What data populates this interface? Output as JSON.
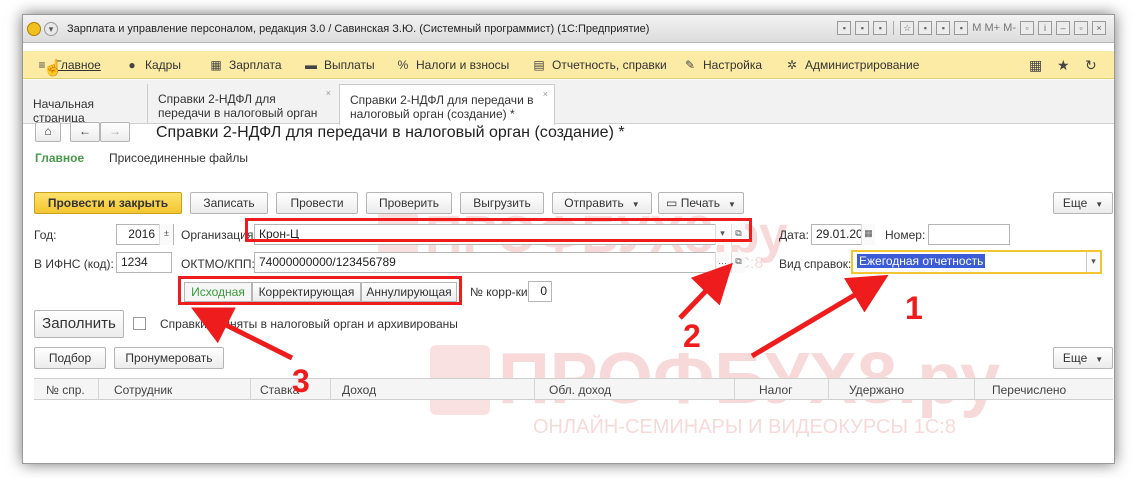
{
  "titlebar": {
    "title": "Зарплата и управление персоналом, редакция 3.0 / Савинская З.Ю. (Системный программист)  (1С:Предприятие)",
    "right_text": "M  M+  M-"
  },
  "menu": {
    "items": [
      {
        "label": "Главное",
        "icon": "hamburger-icon"
      },
      {
        "label": "Кадры",
        "icon": "people-icon"
      },
      {
        "label": "Зарплата",
        "icon": "calculator-icon"
      },
      {
        "label": "Выплаты",
        "icon": "wallet-icon"
      },
      {
        "label": "Налоги и взносы",
        "icon": "percent-icon"
      },
      {
        "label": "Отчетность, справки",
        "icon": "report-icon"
      },
      {
        "label": "Настройка",
        "icon": "wrench-icon"
      },
      {
        "label": "Администрирование",
        "icon": "gear-icon"
      }
    ]
  },
  "tabs": {
    "home": "Начальная страница",
    "t1": "Справки 2-НДФЛ для передачи в налоговый орган",
    "t2": "Справки 2-НДФЛ для передачи в налоговый орган (создание) *"
  },
  "form": {
    "title": "Справки 2-НДФЛ для передачи в налоговый орган (создание) *",
    "link_main": "Главное",
    "link_files": "Присоединенные файлы",
    "buttons": {
      "post_close": "Провести и закрыть",
      "save": "Записать",
      "post": "Провести",
      "check": "Проверить",
      "export": "Выгрузить",
      "send": "Отправить",
      "print": "Печать",
      "more": "Еще"
    },
    "year_label": "Год:",
    "year_value": "2016",
    "org_label": "Организация:",
    "org_value": "Крон-Ц",
    "date_label": "Дата:",
    "date_value": "29.01.20",
    "number_label": "Номер:",
    "number_value": "",
    "ifns_label": "В ИФНС (код):",
    "ifns_value": "1234",
    "oktmo_label": "ОКТМО/КПП:",
    "oktmo_value": "74000000000/123456789",
    "kind_label": "Вид справок:",
    "kind_value": "Ежегодная отчетность",
    "segments": [
      "Исходная",
      "Корректирующая",
      "Аннулирующая"
    ],
    "corr_label": "№ корр-ки:",
    "corr_value": "0",
    "fill_button": "Заполнить",
    "archived_label": "Справки приняты в налоговый орган и архивированы",
    "pick_button": "Подбор",
    "renumber_button": "Пронумеровать",
    "more2": "Еще"
  },
  "table": {
    "columns": [
      "№ спр.",
      "Сотрудник",
      "Ставка",
      "Доход",
      "Обл. доход",
      "Налог",
      "Удержано",
      "Перечислено"
    ]
  },
  "watermark": {
    "brand": "ПРОФБУХ8.ру",
    "tagline": "ОНЛАЙН-СЕМИНАРЫ И ВИДЕОКУРСЫ 1С:8"
  },
  "annotations": [
    "1",
    "2",
    "3"
  ],
  "colors": {
    "accent_red": "#ee1c1c",
    "menu_bg": "#fbeba4",
    "primary_btn": "#f3c530",
    "active_green": "#3a9a3a"
  }
}
